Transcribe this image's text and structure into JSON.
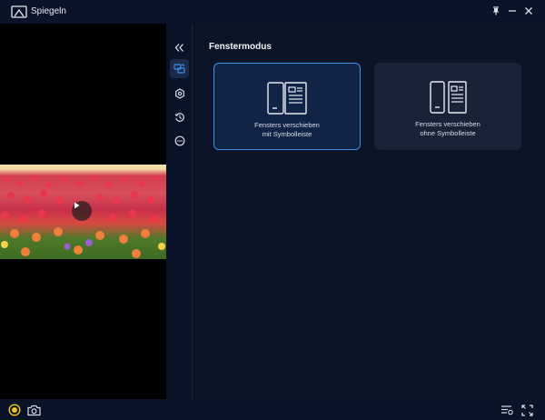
{
  "app": {
    "title": "Spiegeln",
    "icon": "mirror-screen-icon"
  },
  "window_controls": [
    {
      "name": "pin-icon"
    },
    {
      "name": "minimize-icon"
    },
    {
      "name": "close-icon"
    }
  ],
  "sidebar": {
    "items": [
      {
        "name": "collapse-icon",
        "active": false
      },
      {
        "name": "cast-mode-icon",
        "active": true
      },
      {
        "name": "settings-icon",
        "active": false
      },
      {
        "name": "history-icon",
        "active": false
      },
      {
        "name": "more-icon",
        "active": false
      }
    ]
  },
  "main": {
    "section_title": "Fenstermodus",
    "cards": [
      {
        "line1": "Fensters verschieben",
        "line2": "mit Symbolleiste",
        "selected": true
      },
      {
        "line1": "Fensters verschieben",
        "line2": "ohne Symbolleiste",
        "selected": false
      }
    ]
  },
  "bottombar": {
    "left": [
      {
        "name": "record-icon"
      },
      {
        "name": "camera-icon"
      }
    ],
    "right": [
      {
        "name": "list-settings-icon"
      },
      {
        "name": "fullscreen-icon"
      }
    ]
  },
  "colors": {
    "background": "#0c1428",
    "accent": "#3e8fe6",
    "record": "#f0c419"
  }
}
